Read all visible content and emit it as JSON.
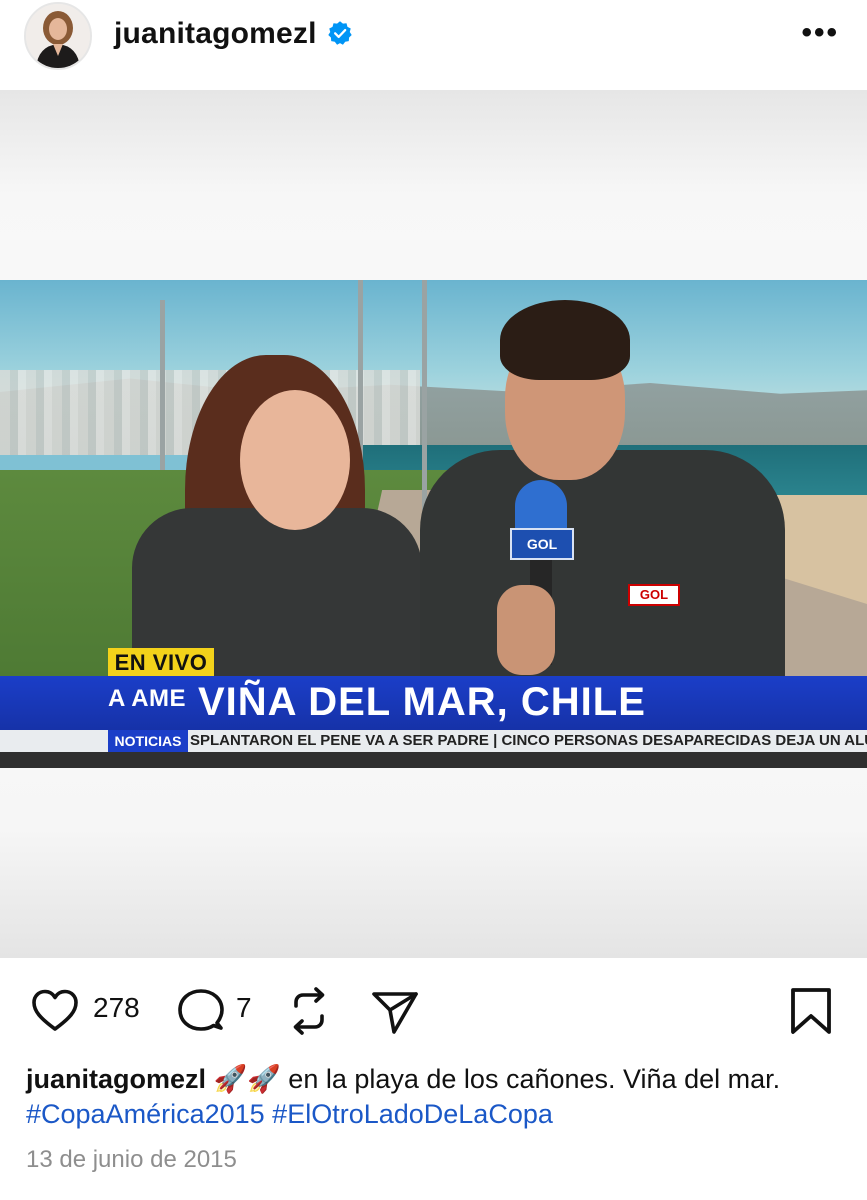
{
  "post": {
    "username": "juanitagomezl",
    "verified": true,
    "more_label": "•••"
  },
  "media": {
    "overlay": {
      "live_label": "EN VIVO",
      "side_text": "A AME",
      "location": "VIÑA DEL MAR, CHILE",
      "channel_label": "NOTICIAS",
      "ticker": "SPLANTARON EL PENE VA A SER PADRE   |   CINCO PERSONAS DESAPARECIDAS DEJA UN ALU",
      "mic_flag": "GOL",
      "shirt_logo": "GOL"
    }
  },
  "actions": {
    "likes": "278",
    "comments": "7"
  },
  "caption": {
    "username": "juanitagomezl",
    "emojis": "🚀🚀",
    "text": " en la playa de los cañones. Viña del mar. ",
    "hashtag1": "#CopaAmérica2015",
    "hashtag2": "#ElOtroLadoDeLaCopa"
  },
  "date": "13 de junio de 2015",
  "colors": {
    "verified": "#0095f6",
    "hashtag": "#1b58c7",
    "live_yellow": "#f3d21a",
    "tv_blue": "#1b3ec8"
  }
}
